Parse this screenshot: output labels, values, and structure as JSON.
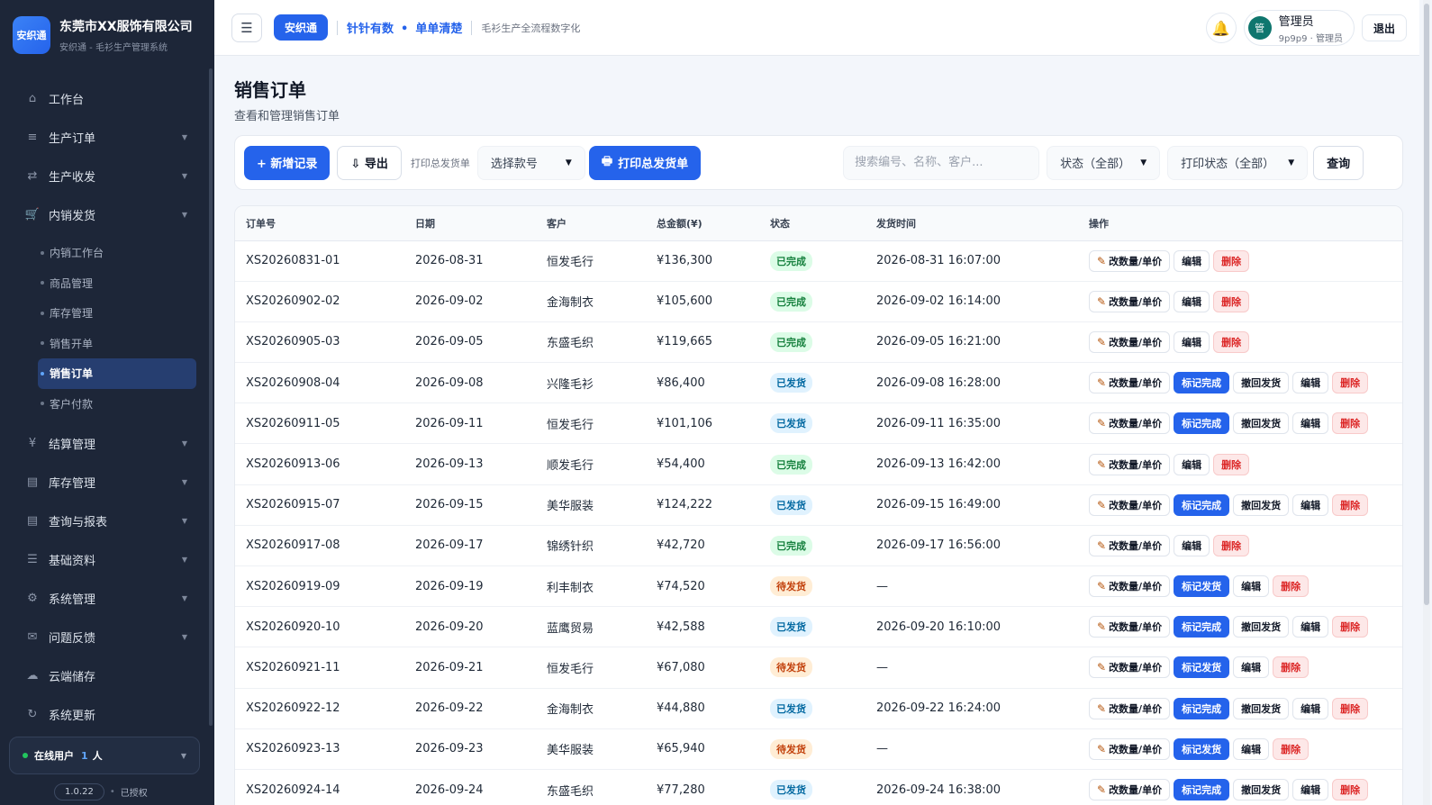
{
  "brand": {
    "logo": "安织通",
    "name": "东莞市XX服饰有限公司",
    "sub": "安织通 - 毛衫生产管理系统"
  },
  "sidebar": {
    "items": [
      {
        "icon": "⌂",
        "label": "工作台"
      },
      {
        "icon": "≡",
        "label": "生产订单"
      },
      {
        "icon": "⇄",
        "label": "生产收发"
      },
      {
        "icon": "🛒",
        "label": "内销发货"
      }
    ],
    "sub_items": [
      "内销工作台",
      "商品管理",
      "库存管理",
      "销售开单",
      "销售订单",
      "客户付款"
    ],
    "items_after": [
      {
        "icon": "¥",
        "label": "结算管理"
      },
      {
        "icon": "▤",
        "label": "库存管理"
      },
      {
        "icon": "▤",
        "label": "查询与报表"
      },
      {
        "icon": "☰",
        "label": "基础资料"
      },
      {
        "icon": "⚙",
        "label": "系统管理"
      },
      {
        "icon": "✉",
        "label": "问题反馈"
      },
      {
        "icon": "☁",
        "label": "云端储存"
      },
      {
        "icon": "↻",
        "label": "系统更新"
      }
    ],
    "online_label": "在线用户",
    "online_count": "1",
    "online_unit": "人",
    "version": "1.0.22",
    "license": "已授权"
  },
  "header": {
    "app_tag": "安织通",
    "slogan_a": "针针有数",
    "slogan_b": "单单清楚",
    "tagline": "毛衫生产全流程数字化",
    "user_name": "管理员",
    "user_meta": "9p9p9 · 管理员",
    "avatar": "管",
    "logout": "退出"
  },
  "page": {
    "title": "销售订单",
    "subtitle": "查看和管理销售订单"
  },
  "toolbar": {
    "add": "+ 新增记录",
    "export": "⇩ 导出",
    "print_label": "打印总发货单",
    "style_select": "选择款号",
    "print_btn": "打印总发货单",
    "search_placeholder": "搜索编号、名称、客户...",
    "status_select": "状态（全部）",
    "print_status_select": "打印状态（全部）",
    "query": "查询"
  },
  "table": {
    "headers": [
      "订单号",
      "日期",
      "客户",
      "总金额(¥)",
      "状态",
      "发货时间",
      "操作"
    ],
    "action_labels": {
      "edit_qty": "改数量/单价",
      "edit": "编辑",
      "delete": "删除",
      "mark_done": "标记完成",
      "withdraw": "撤回发货",
      "mark_ship": "标记发货"
    },
    "rows": [
      {
        "id": "XS20260831-01",
        "date": "2026-08-31",
        "customer": "恒发毛行",
        "amount": "¥136,300",
        "status": "已完成",
        "status_type": "done",
        "ship_time": "2026-08-31 16:07:00"
      },
      {
        "id": "XS20260902-02",
        "date": "2026-09-02",
        "customer": "金海制衣",
        "amount": "¥105,600",
        "status": "已完成",
        "status_type": "done",
        "ship_time": "2026-09-02 16:14:00"
      },
      {
        "id": "XS20260905-03",
        "date": "2026-09-05",
        "customer": "东盛毛织",
        "amount": "¥119,665",
        "status": "已完成",
        "status_type": "done",
        "ship_time": "2026-09-05 16:21:00"
      },
      {
        "id": "XS20260908-04",
        "date": "2026-09-08",
        "customer": "兴隆毛衫",
        "amount": "¥86,400",
        "status": "已发货",
        "status_type": "shipped",
        "ship_time": "2026-09-08 16:28:00"
      },
      {
        "id": "XS20260911-05",
        "date": "2026-09-11",
        "customer": "恒发毛行",
        "amount": "¥101,106",
        "status": "已发货",
        "status_type": "shipped",
        "ship_time": "2026-09-11 16:35:00"
      },
      {
        "id": "XS20260913-06",
        "date": "2026-09-13",
        "customer": "顺发毛行",
        "amount": "¥54,400",
        "status": "已完成",
        "status_type": "done",
        "ship_time": "2026-09-13 16:42:00"
      },
      {
        "id": "XS20260915-07",
        "date": "2026-09-15",
        "customer": "美华服装",
        "amount": "¥124,222",
        "status": "已发货",
        "status_type": "shipped",
        "ship_time": "2026-09-15 16:49:00"
      },
      {
        "id": "XS20260917-08",
        "date": "2026-09-17",
        "customer": "锦绣针织",
        "amount": "¥42,720",
        "status": "已完成",
        "status_type": "done",
        "ship_time": "2026-09-17 16:56:00"
      },
      {
        "id": "XS20260919-09",
        "date": "2026-09-19",
        "customer": "利丰制衣",
        "amount": "¥74,520",
        "status": "待发货",
        "status_type": "pending",
        "ship_time": "—"
      },
      {
        "id": "XS20260920-10",
        "date": "2026-09-20",
        "customer": "蓝鹰贸易",
        "amount": "¥42,588",
        "status": "已发货",
        "status_type": "shipped",
        "ship_time": "2026-09-20 16:10:00"
      },
      {
        "id": "XS20260921-11",
        "date": "2026-09-21",
        "customer": "恒发毛行",
        "amount": "¥67,080",
        "status": "待发货",
        "status_type": "pending",
        "ship_time": "—"
      },
      {
        "id": "XS20260922-12",
        "date": "2026-09-22",
        "customer": "金海制衣",
        "amount": "¥44,880",
        "status": "已发货",
        "status_type": "shipped",
        "ship_time": "2026-09-22 16:24:00"
      },
      {
        "id": "XS20260923-13",
        "date": "2026-09-23",
        "customer": "美华服装",
        "amount": "¥65,940",
        "status": "待发货",
        "status_type": "pending",
        "ship_time": "—"
      },
      {
        "id": "XS20260924-14",
        "date": "2026-09-24",
        "customer": "东盛毛织",
        "amount": "¥77,280",
        "status": "已发货",
        "status_type": "shipped",
        "ship_time": "2026-09-24 16:38:00"
      }
    ]
  }
}
